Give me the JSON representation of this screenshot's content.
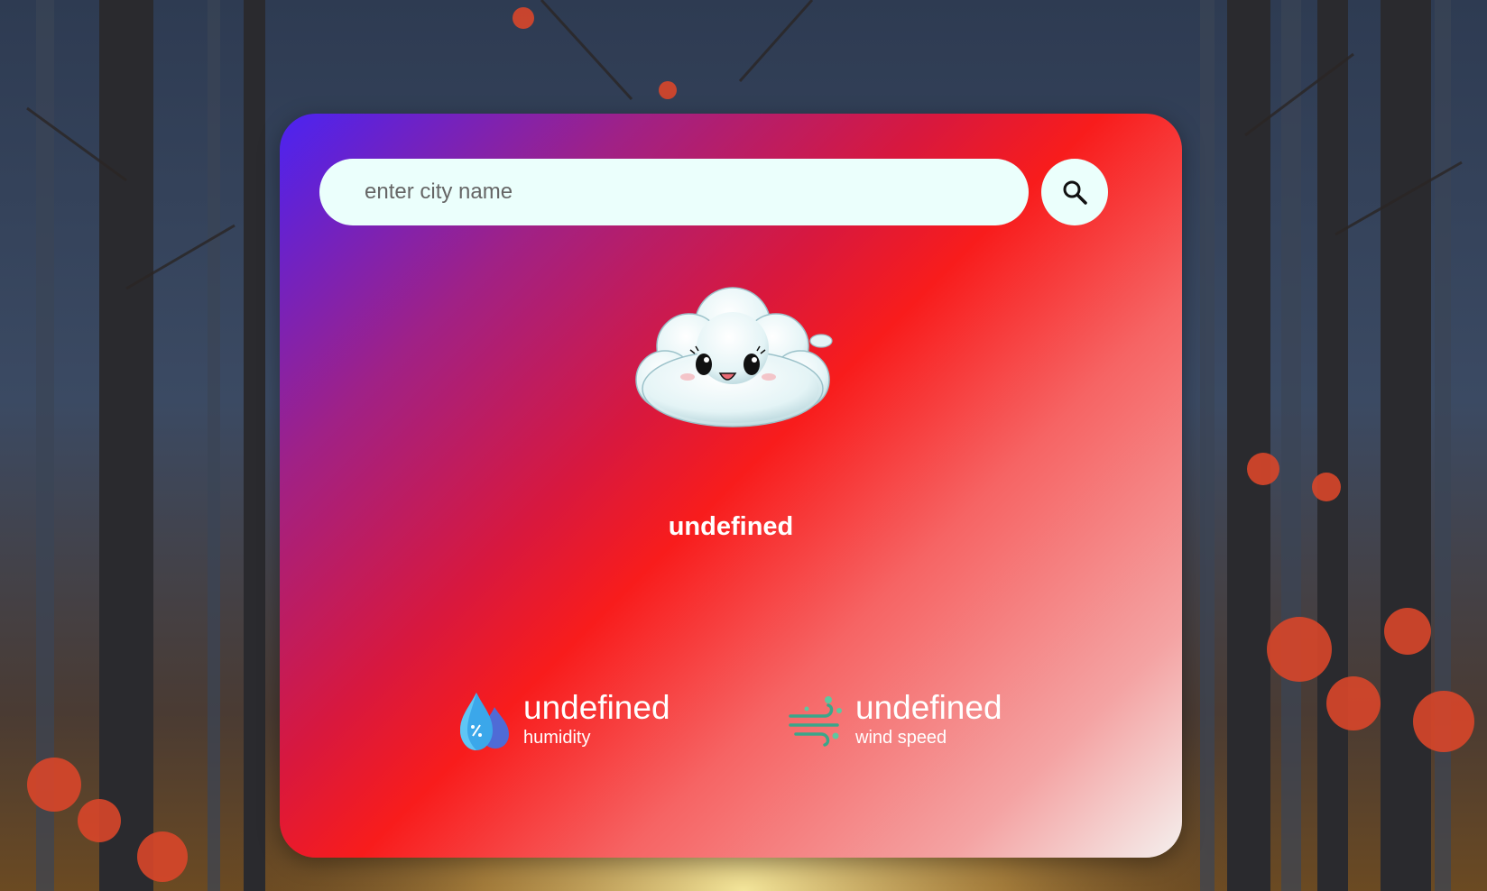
{
  "search": {
    "placeholder": "enter city name",
    "value": ""
  },
  "icons": {
    "search": "magnifier-icon",
    "weather": "cloud-icon",
    "humidity": "humidity-drop-icon",
    "wind": "wind-icon"
  },
  "weather": {
    "city": "undefined"
  },
  "details": {
    "humidity": {
      "value": "undefined",
      "label": "humidity"
    },
    "wind": {
      "value": "undefined",
      "label": "wind speed"
    }
  },
  "colors": {
    "card_gradient": [
      "#4b23f2",
      "#a02186",
      "#f81c1c",
      "#f66464",
      "#f4f0ee"
    ],
    "input_bg": "#ebfffc",
    "text": "#ffffff"
  }
}
